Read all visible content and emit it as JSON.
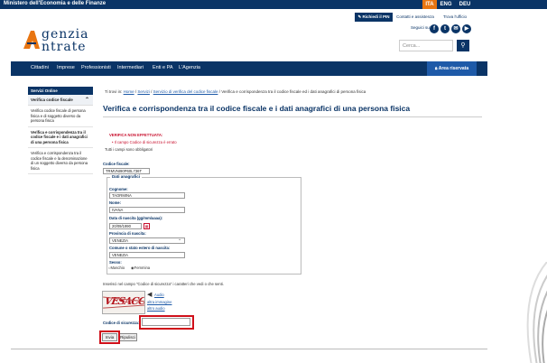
{
  "topbar": {
    "ministry": "Ministero dell'Economia e delle Finanze",
    "langs": [
      "ITA",
      "ENG",
      "DEU"
    ]
  },
  "header": {
    "logo_line1": "genzia",
    "logo_line2": "ntrate",
    "pin_button": "Richiedi il PIN",
    "contacts": "Contatti e assistenza",
    "find_office": "Trova l'ufficio",
    "follow_us": "Seguici su:",
    "search_placeholder": "Cerca...",
    "social": [
      "f",
      "t",
      "✉",
      "▶"
    ]
  },
  "nav": {
    "items": [
      "Cittadini",
      "Imprese",
      "Professionisti",
      "Intermediari",
      "Enti e PA",
      "L'Agenzia"
    ],
    "area": "Area riservata"
  },
  "sidebar": {
    "heading": "Servizi Online",
    "subheading": "Verifica codice fiscale",
    "items": [
      "Verifica codice fiscale di persona fisica e di soggetto diverso da persona fisica",
      "Verifica e corrispondenza tra il codice fiscale e i dati anagrafici di una persona fisica",
      "Verifica e corrispondenza tra il codice fiscale e la denominazione di un soggetto diverso da persona fisica"
    ]
  },
  "breadcrumb": {
    "prefix": "Ti trovi in:",
    "home": "Home",
    "servizi": "Servizi",
    "verifica": "Servizio di verifica del codice fiscale",
    "current": "Verifica e corrispondenza tra il codice fiscale ed i dati anagrafici di persona fisica"
  },
  "page_title": "Verifica e corrispondenza tra il codice fiscale e i dati anagrafici di una persona fisica",
  "form": {
    "error_title": "VERIFICA NON EFFETTUATA:",
    "error_msg": "Il campo Codice di sicurezza è errato",
    "required_note": "Tutti i campi sono obbligatori",
    "cf_label": "Codice fiscale:",
    "cf_value": "TRMVNI90P60L736T",
    "legend": "Dati anagrafici",
    "cognome_label": "Cognome:",
    "cognome_value": "TAORMINA",
    "nome_label": "Nome:",
    "nome_value": "IVANA",
    "nascita_label": "Data di nascita (gg/mm/aaaa):",
    "nascita_value": "20/09/1990",
    "provincia_label": "Provincia di nascita:",
    "provincia_value": "VENEZIA",
    "comune_label": "Comune o stato estero di nascita:",
    "comune_value": "VENEZIA",
    "sesso_label": "Sesso:",
    "maschio": "Maschio",
    "femmina": "Femmina",
    "captcha_note": "Inserisci nel campo \"Codice di sicurezza\" i caratteri che vedi o che senti.",
    "captcha_text": "VESACC1",
    "audio": "Audio",
    "altra_immagine": "altra immagine",
    "altro_audio": "altro audio",
    "codice_label": "Codice di sicurezza:",
    "codice_value": "",
    "invia": "Invia",
    "ripulisci": "Ripulisci"
  }
}
